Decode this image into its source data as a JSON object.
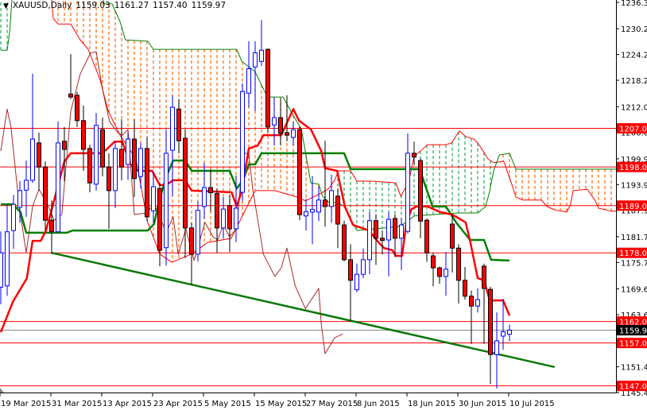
{
  "header": {
    "symbol": "XAUUSD,Daily",
    "open": "1159.03",
    "high": "1161.27",
    "low": "1157.40",
    "close": "1159.97",
    "menu_icon": "triangle-down-icon"
  },
  "colors": {
    "bull": "#0000ff",
    "bear_fill": "#ff0000",
    "bear_outline": "#000000",
    "tenkan": "#ff0000",
    "kijun": "#008000",
    "chikou": "#a52a2a",
    "span_a": "#ff0000",
    "span_b": "#008000",
    "cloud_bear": "#ff6600",
    "cloud_bull": "#22aa55",
    "level": "#ff0000",
    "trendline": "#087808",
    "current_price": "#808080"
  },
  "chart_data": {
    "type": "candlestick",
    "title": "XAUUSD,Daily",
    "ylim": [
      1145.45,
      1236.9
    ],
    "price_ticks": [
      "1236.35",
      "1230.20",
      "1224.20",
      "1218.20",
      "1212.05",
      "1206.05",
      "1199.90",
      "1193.90",
      "1187.90",
      "1181.75",
      "1175.75",
      "1169.60",
      "1163.60",
      "1151.45",
      "1145.45"
    ],
    "date_ticks": [
      {
        "bar": 0,
        "label": "19 Mar 2015"
      },
      {
        "bar": 8,
        "label": "31 Mar 2015"
      },
      {
        "bar": 16,
        "label": "13 Apr 2015"
      },
      {
        "bar": 24,
        "label": "23 Apr 2015"
      },
      {
        "bar": 32,
        "label": "5 May 2015"
      },
      {
        "bar": 40,
        "label": "15 May 2015"
      },
      {
        "bar": 48,
        "label": "27 May 2015"
      },
      {
        "bar": 56,
        "label": "8 Jun 2015"
      },
      {
        "bar": 64,
        "label": "18 Jun 2015"
      },
      {
        "bar": 72,
        "label": "30 Jun 2015"
      },
      {
        "bar": 80,
        "label": "10 Jul 2015"
      }
    ],
    "candles_ohlc": [
      [
        1170,
        1183,
        1166,
        1178
      ],
      [
        1170.3,
        1189.3,
        1168,
        1182.9
      ],
      [
        1183.2,
        1191.5,
        1178.9,
        1189.3
      ],
      [
        1188.6,
        1194.7,
        1185,
        1192.5
      ],
      [
        1192.6,
        1199.5,
        1186.4,
        1194.9
      ],
      [
        1194.9,
        1219.7,
        1194.3,
        1204.5
      ],
      [
        1203.6,
        1206,
        1192.5,
        1198
      ],
      [
        1198,
        1199.3,
        1183.2,
        1185.6
      ],
      [
        1185.6,
        1190.2,
        1177.7,
        1182.9
      ],
      [
        1182.9,
        1208.6,
        1182.7,
        1203.6
      ],
      [
        1204,
        1207.3,
        1194.7,
        1202.1
      ],
      [
        1215,
        1224.3,
        1213.8,
        1214.3
      ],
      [
        1214.7,
        1215.5,
        1207.3,
        1208.8
      ],
      [
        1208.8,
        1212.3,
        1197.1,
        1202.1
      ],
      [
        1202.3,
        1203.2,
        1192.1,
        1194.3
      ],
      [
        1194,
        1210.6,
        1192.5,
        1207.7
      ],
      [
        1206.7,
        1209.5,
        1195.8,
        1198
      ],
      [
        1198,
        1201.2,
        1183.6,
        1192.5
      ],
      [
        1192.5,
        1204.1,
        1188.4,
        1202.3
      ],
      [
        1202.1,
        1209.1,
        1194.9,
        1198
      ],
      [
        1198.6,
        1206,
        1195,
        1204.5
      ],
      [
        1204.5,
        1209.1,
        1191,
        1195.3
      ],
      [
        1195.8,
        1203.6,
        1193,
        1202.3
      ],
      [
        1202.3,
        1204.9,
        1185.4,
        1186.4
      ],
      [
        1187.8,
        1197,
        1185,
        1193.4
      ],
      [
        1193,
        1194.3,
        1174.9,
        1178.6
      ],
      [
        1179.2,
        1206.7,
        1175,
        1201.2
      ],
      [
        1201.9,
        1214.7,
        1191.2,
        1211.9
      ],
      [
        1211.5,
        1213.8,
        1201.2,
        1204.1
      ],
      [
        1204.7,
        1206.7,
        1176.8,
        1183.8
      ],
      [
        1183.8,
        1185,
        1170.6,
        1177.7
      ],
      [
        1177.7,
        1190,
        1176,
        1187.9
      ],
      [
        1188.8,
        1198.9,
        1186,
        1193.2
      ],
      [
        1193.2,
        1197.5,
        1187.5,
        1192
      ],
      [
        1191.8,
        1193,
        1178,
        1183.8
      ],
      [
        1183.8,
        1191,
        1181.4,
        1188.2
      ],
      [
        1189,
        1191.5,
        1178.2,
        1183.6
      ],
      [
        1183.6,
        1196,
        1180.5,
        1188.4
      ],
      [
        1192.1,
        1217.5,
        1190,
        1215.6
      ],
      [
        1215.2,
        1227.3,
        1211.9,
        1220.9
      ],
      [
        1221.3,
        1227.3,
        1211,
        1224.6
      ],
      [
        1222.6,
        1232.2,
        1221.5,
        1225.2
      ],
      [
        1225.4,
        1225.6,
        1206,
        1207.3
      ],
      [
        1207.8,
        1214.1,
        1203,
        1209.5
      ],
      [
        1209.5,
        1214,
        1203,
        1205.8
      ],
      [
        1206,
        1214.7,
        1204,
        1205.4
      ],
      [
        1204.9,
        1208.6,
        1203,
        1206.7
      ],
      [
        1206.7,
        1207.5,
        1185.6,
        1186.9
      ],
      [
        1186.6,
        1190.6,
        1183.2,
        1187.6
      ],
      [
        1187.5,
        1195.9,
        1180,
        1188.1
      ],
      [
        1187.5,
        1193.4,
        1185.4,
        1190.3
      ],
      [
        1190.3,
        1204.1,
        1184.1,
        1188.8
      ],
      [
        1188.8,
        1196.2,
        1185,
        1192.5
      ],
      [
        1191.2,
        1193,
        1179.1,
        1184.7
      ],
      [
        1184.5,
        1185.5,
        1176,
        1176.4
      ],
      [
        1176.4,
        1180,
        1161.9,
        1171.6
      ],
      [
        1169.4,
        1175.5,
        1168.8,
        1173
      ],
      [
        1173,
        1179,
        1172.1,
        1176.4
      ],
      [
        1176.4,
        1187.5,
        1173,
        1185.5
      ],
      [
        1185.5,
        1187,
        1175.2,
        1181.4
      ],
      [
        1181.4,
        1183.2,
        1177.6,
        1180.9
      ],
      [
        1181,
        1187.5,
        1172.5,
        1185.8
      ],
      [
        1186,
        1187,
        1177,
        1181.4
      ],
      [
        1181.4,
        1186,
        1174,
        1184.5
      ],
      [
        1183,
        1205.8,
        1182.5,
        1201.2
      ],
      [
        1201.2,
        1203.9,
        1198.6,
        1200.3
      ],
      [
        1199.5,
        1200,
        1181.4,
        1185.4
      ],
      [
        1185.6,
        1186,
        1175.9,
        1178
      ],
      [
        1177.3,
        1178,
        1170.2,
        1174.5
      ],
      [
        1174.5,
        1174.8,
        1170.8,
        1172.5
      ],
      [
        1172.5,
        1178.2,
        1168,
        1174.2
      ],
      [
        1184.7,
        1186.9,
        1173.4,
        1179.1
      ],
      [
        1179.1,
        1180,
        1166.2,
        1171.6
      ],
      [
        1171.6,
        1174.7,
        1167.1,
        1167.9
      ],
      [
        1167.9,
        1169.2,
        1156.8,
        1165.6
      ],
      [
        1165.6,
        1169.7,
        1164.1,
        1167.1
      ],
      [
        1174.9,
        1175.5,
        1156.8,
        1169.7
      ],
      [
        1169.5,
        1170.1,
        1147.4,
        1154.3
      ],
      [
        1154.3,
        1164.1,
        1146.4,
        1157.5
      ],
      [
        1158.6,
        1167.3,
        1155.4,
        1159.6
      ],
      [
        1159.03,
        1161.27,
        1157.4,
        1159.97
      ]
    ],
    "tenkan_sen": [
      [
        0,
        1159.5
      ],
      [
        1.9,
        1166.6
      ],
      [
        4.1,
        1172.1
      ],
      [
        5,
        1180.8
      ],
      [
        6.3,
        1180.8
      ],
      [
        7.1,
        1183.2
      ],
      [
        7.9,
        1187.5
      ],
      [
        10,
        1199.3
      ],
      [
        11,
        1201.2
      ],
      [
        16,
        1201.2
      ],
      [
        17.9,
        1203.9
      ],
      [
        19.1,
        1203.9
      ],
      [
        20.4,
        1198.6
      ],
      [
        21.6,
        1197.1
      ],
      [
        23.8,
        1197.1
      ],
      [
        25,
        1193.8
      ],
      [
        26,
        1193.8
      ],
      [
        27.1,
        1194.9
      ],
      [
        29,
        1194.9
      ],
      [
        30,
        1192.5
      ],
      [
        36.3,
        1192.1
      ],
      [
        37.1,
        1188.8
      ],
      [
        37.9,
        1192.5
      ],
      [
        39,
        1202.3
      ],
      [
        40.4,
        1203.0
      ],
      [
        41.3,
        1205.4
      ],
      [
        44.1,
        1205.4
      ],
      [
        46,
        1211.5
      ],
      [
        46.9,
        1208.8
      ],
      [
        48.8,
        1206.7
      ],
      [
        50.4,
        1201.7
      ],
      [
        51,
        1197.7
      ],
      [
        52.9,
        1197.1
      ],
      [
        54.1,
        1188.8
      ],
      [
        55.4,
        1184.5
      ],
      [
        57.9,
        1183.2
      ],
      [
        59.6,
        1180.1
      ],
      [
        60.3,
        1179.1
      ],
      [
        61.6,
        1178.6
      ],
      [
        62.1,
        1177.3
      ],
      [
        63.1,
        1177.3
      ],
      [
        63.8,
        1185.1
      ],
      [
        64.6,
        1188.2
      ],
      [
        65.4,
        1188.8
      ],
      [
        67.1,
        1188.8
      ],
      [
        69.1,
        1187.5
      ],
      [
        71,
        1186.9
      ],
      [
        73.1,
        1185.1
      ],
      [
        73.8,
        1180.8
      ],
      [
        75,
        1172.1
      ],
      [
        76,
        1171.6
      ],
      [
        76.9,
        1166.9
      ],
      [
        79,
        1166.9
      ],
      [
        80,
        1163.4
      ]
    ],
    "kijun_sen": [
      [
        0,
        1189.3
      ],
      [
        1.9,
        1189.3
      ],
      [
        3.1,
        1187.5
      ],
      [
        4,
        1182.7
      ],
      [
        10.4,
        1182.7
      ],
      [
        11.3,
        1183.2
      ],
      [
        23.1,
        1183.2
      ],
      [
        24.1,
        1184.7
      ],
      [
        25,
        1190.6
      ],
      [
        26,
        1195.6
      ],
      [
        27.1,
        1199.5
      ],
      [
        29,
        1199.5
      ],
      [
        30,
        1197.1
      ],
      [
        36,
        1197.1
      ],
      [
        37.1,
        1193.0
      ],
      [
        38.1,
        1194.9
      ],
      [
        39,
        1198.6
      ],
      [
        40,
        1198.6
      ],
      [
        41,
        1201.2
      ],
      [
        54,
        1201.2
      ],
      [
        55,
        1197.5
      ],
      [
        65.9,
        1197.5
      ],
      [
        66.6,
        1194.3
      ],
      [
        67.9,
        1188.8
      ],
      [
        70,
        1188.8
      ],
      [
        71.6,
        1185.1
      ],
      [
        73.8,
        1181.0
      ],
      [
        76,
        1181.0
      ],
      [
        77.1,
        1176.4
      ],
      [
        80,
        1176.2
      ]
    ],
    "chikou_span": [
      [
        0,
        1201.7
      ],
      [
        1,
        1211.5
      ],
      [
        1.6,
        1207.3
      ],
      [
        2.9,
        1188.8
      ],
      [
        4,
        1178.0
      ],
      [
        5,
        1188.8
      ],
      [
        6,
        1192.8
      ],
      [
        7.1,
        1190.1
      ],
      [
        8.4,
        1185.6
      ],
      [
        9.6,
        1186.9
      ],
      [
        11,
        1211.0
      ],
      [
        12.5,
        1219.7
      ],
      [
        14.1,
        1224.5
      ],
      [
        15,
        1224.9
      ],
      [
        16,
        1216.0
      ],
      [
        17.1,
        1208.6
      ],
      [
        18.4,
        1206.0
      ],
      [
        19.1,
        1205.4
      ],
      [
        20,
        1206.7
      ],
      [
        21,
        1186.9
      ],
      [
        22.9,
        1187.3
      ],
      [
        24.1,
        1189.3
      ],
      [
        25,
        1186.4
      ],
      [
        26,
        1182.7
      ],
      [
        27.1,
        1186.4
      ],
      [
        27.9,
        1177.6
      ],
      [
        29.1,
        1183.6
      ],
      [
        30.4,
        1176.2
      ],
      [
        32.1,
        1185.1
      ],
      [
        33.4,
        1181.7
      ],
      [
        34.1,
        1181.0
      ],
      [
        35,
        1184.5
      ],
      [
        36,
        1181.7
      ],
      [
        37.1,
        1183.8
      ],
      [
        38.1,
        1201.2
      ],
      [
        39,
        1201.2
      ],
      [
        39.6,
        1193.0
      ],
      [
        41.3,
        1177.7
      ],
      [
        43.1,
        1172.5
      ],
      [
        44.1,
        1174.5
      ],
      [
        45,
        1179.1
      ],
      [
        46.3,
        1170.3
      ],
      [
        47.9,
        1165.0
      ],
      [
        50,
        1169.7
      ],
      [
        50.4,
        1161.4
      ],
      [
        51,
        1154.5
      ],
      [
        52.5,
        1158.2
      ],
      [
        53.8,
        1159.1
      ]
    ],
    "senkou_span_a": [
      [
        0,
        1248
      ],
      [
        7.5,
        1238.8
      ],
      [
        8,
        1236.9
      ],
      [
        8.25,
        1232.6
      ],
      [
        9,
        1231.3
      ],
      [
        11,
        1231.3
      ],
      [
        12.5,
        1227.6
      ],
      [
        13.75,
        1225.4
      ],
      [
        15.6,
        1218.4
      ],
      [
        16.9,
        1211.0
      ],
      [
        18.75,
        1205.4
      ],
      [
        21.25,
        1199.9
      ],
      [
        23.1,
        1185.1
      ],
      [
        25,
        1177.7
      ],
      [
        26.9,
        1175.8
      ],
      [
        30,
        1177.7
      ],
      [
        32.5,
        1180.4
      ],
      [
        36.25,
        1181.4
      ],
      [
        38.1,
        1186.9
      ],
      [
        40,
        1192.5
      ],
      [
        43.1,
        1192.5
      ],
      [
        46.6,
        1191.0
      ],
      [
        47.9,
        1190.1
      ],
      [
        50.4,
        1191.9
      ],
      [
        51.6,
        1193.0
      ],
      [
        52.5,
        1194.9
      ],
      [
        53.1,
        1197.1
      ],
      [
        55,
        1197.1
      ],
      [
        56,
        1194.7
      ],
      [
        58.4,
        1194.7
      ],
      [
        62.1,
        1194.3
      ],
      [
        62.9,
        1191.2
      ],
      [
        64.1,
        1194.3
      ],
      [
        65,
        1200.4
      ],
      [
        67.1,
        1203.2
      ],
      [
        70,
        1203.2
      ],
      [
        70.9,
        1203.6
      ],
      [
        72.1,
        1206.4
      ],
      [
        73.1,
        1205.1
      ],
      [
        74.4,
        1204.5
      ],
      [
        75,
        1203.6
      ],
      [
        76,
        1201.4
      ],
      [
        76.6,
        1199.9
      ],
      [
        77.5,
        1199.0
      ],
      [
        79.1,
        1199.3
      ],
      [
        80.4,
        1193.8
      ],
      [
        81,
        1191.0
      ],
      [
        82.1,
        1190.3
      ],
      [
        85,
        1190.3
      ],
      [
        85.9,
        1188.8
      ],
      [
        87.1,
        1188.0
      ],
      [
        89,
        1187.5
      ],
      [
        89.6,
        1189.3
      ],
      [
        90,
        1192.5
      ],
      [
        92.25,
        1192.8
      ],
      [
        93.5,
        1190.1
      ],
      [
        94,
        1188.4
      ],
      [
        96,
        1187.7
      ],
      [
        97,
        1187.7
      ]
    ],
    "senkou_span_b": [
      [
        0,
        1225.2
      ],
      [
        1,
        1225.2
      ],
      [
        1.4,
        1229.5
      ],
      [
        1.75,
        1236.9
      ],
      [
        2,
        1244.3
      ],
      [
        15,
        1244.3
      ],
      [
        16.25,
        1236.0
      ],
      [
        17.5,
        1236.0
      ],
      [
        18.75,
        1231.9
      ],
      [
        19.6,
        1227.6
      ],
      [
        23.1,
        1227.3
      ],
      [
        24,
        1225.4
      ],
      [
        37.1,
        1225.4
      ],
      [
        37.9,
        1222.6
      ],
      [
        40,
        1220.2
      ],
      [
        41.5,
        1215.6
      ],
      [
        41.9,
        1214.3
      ],
      [
        44.4,
        1214.3
      ],
      [
        45.6,
        1211.0
      ],
      [
        47.25,
        1206.9
      ],
      [
        48.1,
        1199.9
      ],
      [
        48.75,
        1194.3
      ],
      [
        50,
        1194.0
      ],
      [
        50.6,
        1191.2
      ],
      [
        51.6,
        1189.7
      ],
      [
        53.1,
        1189.7
      ],
      [
        54,
        1188.8
      ],
      [
        55.25,
        1185.1
      ],
      [
        56,
        1183.2
      ],
      [
        62.5,
        1184.1
      ],
      [
        63.75,
        1185.1
      ],
      [
        65,
        1186.6
      ],
      [
        72,
        1187.3
      ],
      [
        75,
        1187.3
      ],
      [
        76.25,
        1188.8
      ],
      [
        76.9,
        1192.5
      ],
      [
        77.5,
        1197.1
      ],
      [
        78.4,
        1200.8
      ],
      [
        80,
        1201.2
      ],
      [
        80.6,
        1199.0
      ],
      [
        81,
        1197.5
      ],
      [
        97,
        1197.5
      ]
    ],
    "trendline": [
      [
        8,
        1178.0
      ],
      [
        87.1,
        1151.4
      ]
    ],
    "levels": [
      "1207.00",
      "1198.00",
      "1189.00",
      "1178.00",
      "1162.00",
      "1157.00",
      "1147.00"
    ],
    "current_price": "1159.97"
  }
}
